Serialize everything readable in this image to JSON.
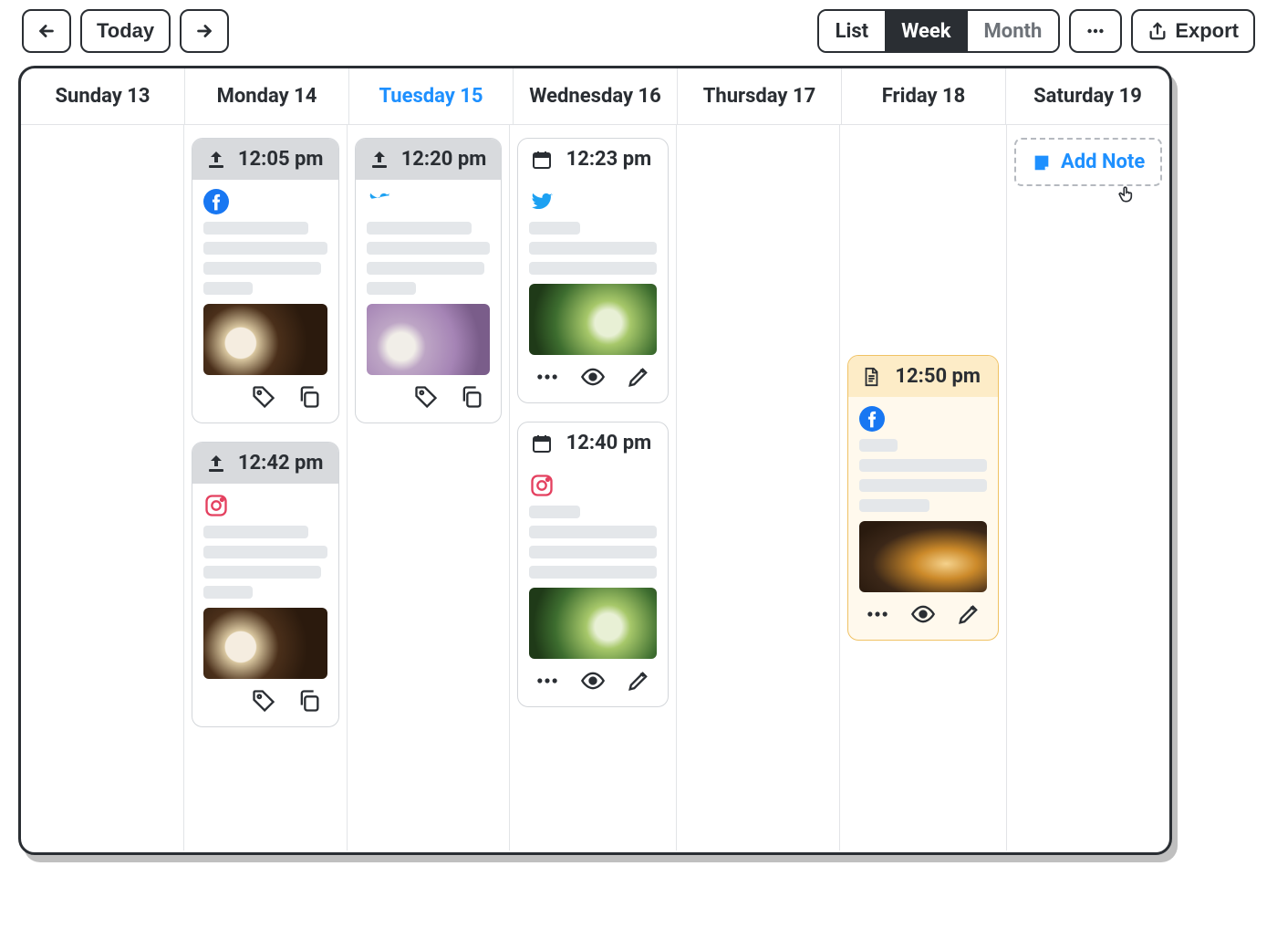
{
  "toolbar": {
    "today_label": "Today",
    "views": {
      "list": "List",
      "week": "Week",
      "month": "Month"
    },
    "active_view": "week",
    "export_label": "Export"
  },
  "calendar": {
    "days": [
      {
        "label": "Sunday 13",
        "is_today": false
      },
      {
        "label": "Monday 14",
        "is_today": false
      },
      {
        "label": "Tuesday 15",
        "is_today": true
      },
      {
        "label": "Wednesday 16",
        "is_today": false
      },
      {
        "label": "Thursday 17",
        "is_today": false
      },
      {
        "label": "Friday 18",
        "is_today": false
      },
      {
        "label": "Saturday 19",
        "is_today": false
      }
    ]
  },
  "add_note": {
    "label": "Add Note"
  },
  "posts": {
    "mon_1": {
      "time": "12:05 pm",
      "status": "published",
      "network": "facebook",
      "thumb": "coffee",
      "actions": [
        "tag",
        "copy"
      ]
    },
    "mon_2": {
      "time": "12:42 pm",
      "status": "published",
      "network": "instagram",
      "thumb": "coffee",
      "actions": [
        "tag",
        "copy"
      ]
    },
    "tue_1": {
      "time": "12:20 pm",
      "status": "published",
      "network": "twitter",
      "thumb": "lilac",
      "actions": [
        "tag",
        "copy"
      ]
    },
    "wed_1": {
      "time": "12:23 pm",
      "status": "scheduled",
      "network": "twitter",
      "thumb": "matcha",
      "actions": [
        "more",
        "view",
        "edit"
      ]
    },
    "wed_2": {
      "time": "12:40 pm",
      "status": "scheduled",
      "network": "instagram",
      "thumb": "matcha",
      "actions": [
        "more",
        "view",
        "edit"
      ]
    },
    "fri_1": {
      "time": "12:50 pm",
      "status": "draft",
      "network": "facebook",
      "thumb": "whiskey",
      "actions": [
        "more",
        "view",
        "edit"
      ]
    }
  }
}
